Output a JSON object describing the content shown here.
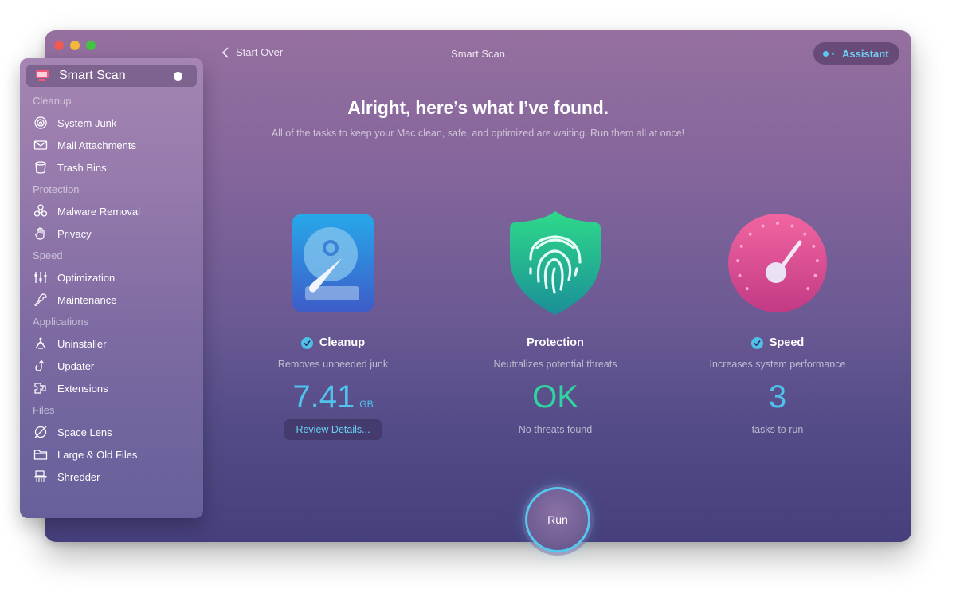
{
  "window": {
    "title": "Smart Scan",
    "back_label": "Start Over",
    "assistant_label": "Assistant"
  },
  "sidebar": {
    "active": {
      "label": "Smart Scan",
      "icon": "monitor-scan-icon"
    },
    "sections": [
      {
        "heading": "Cleanup",
        "items": [
          {
            "label": "System Junk",
            "icon": "system-junk-icon"
          },
          {
            "label": "Mail Attachments",
            "icon": "mail-icon"
          },
          {
            "label": "Trash Bins",
            "icon": "trash-bin-icon"
          }
        ]
      },
      {
        "heading": "Protection",
        "items": [
          {
            "label": "Malware Removal",
            "icon": "biohazard-icon"
          },
          {
            "label": "Privacy",
            "icon": "hand-icon"
          }
        ]
      },
      {
        "heading": "Speed",
        "items": [
          {
            "label": "Optimization",
            "icon": "sliders-icon"
          },
          {
            "label": "Maintenance",
            "icon": "wrench-icon"
          }
        ]
      },
      {
        "heading": "Applications",
        "items": [
          {
            "label": "Uninstaller",
            "icon": "uninstaller-icon"
          },
          {
            "label": "Updater",
            "icon": "updater-icon"
          },
          {
            "label": "Extensions",
            "icon": "puzzle-icon"
          }
        ]
      },
      {
        "heading": "Files",
        "items": [
          {
            "label": "Space Lens",
            "icon": "space-lens-icon"
          },
          {
            "label": "Large & Old Files",
            "icon": "folder-icon"
          },
          {
            "label": "Shredder",
            "icon": "shredder-icon"
          }
        ]
      }
    ]
  },
  "main": {
    "headline": "Alright, here’s what I’ve found.",
    "subline": "All of the tasks to keep your Mac clean, safe, and optimized are waiting. Run them all at once!",
    "cards": [
      {
        "title": "Cleanup",
        "checked": true,
        "description": "Removes unneeded junk",
        "value": "7.41",
        "unit": "GB",
        "action": "Review Details...",
        "value_color": "#4fc3ee"
      },
      {
        "title": "Protection",
        "checked": false,
        "description": "Neutralizes potential threats",
        "value": "OK",
        "footer": "No threats found",
        "value_color": "#2fd4a0"
      },
      {
        "title": "Speed",
        "checked": true,
        "description": "Increases system performance",
        "value": "3",
        "footer": "tasks to run",
        "value_color": "#4fc3ee"
      }
    ],
    "run_label": "Run"
  },
  "colors": {
    "accent": "#54c8ee",
    "ok_green": "#2fd4a0"
  }
}
